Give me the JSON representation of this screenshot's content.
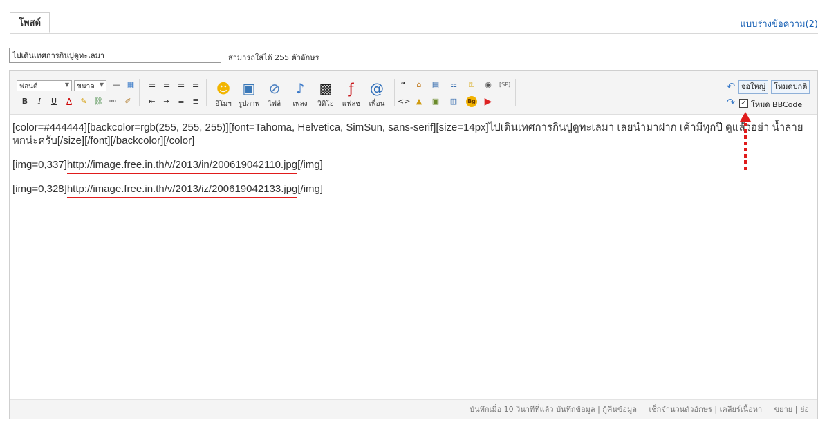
{
  "tab": {
    "label": "โพสต์"
  },
  "drafts_link": "แบบร่างข้อความ(2)",
  "subject": {
    "value": "ไปเดินเทศการกินปูดูทะเลมา",
    "hint": "สามารถใส่ได้ 255 ตัวอักษร"
  },
  "toolbar": {
    "font_select": "ฟอนต์",
    "size_select": "ขนาด",
    "format": {
      "bold": "B",
      "italic": "I",
      "underline": "U"
    },
    "media_buttons": [
      {
        "label": "อิโมฯ",
        "icon": "smiley-icon"
      },
      {
        "label": "รูปภาพ",
        "icon": "image-icon"
      },
      {
        "label": "ไฟล์",
        "icon": "paperclip-icon"
      },
      {
        "label": "เพลง",
        "icon": "music-note-icon"
      },
      {
        "label": "วิดิโอ",
        "icon": "clapperboard-icon"
      },
      {
        "label": "แฟลช",
        "icon": "flash-icon"
      },
      {
        "label": "เพื่อน",
        "icon": "at-icon"
      }
    ],
    "sp_tag": "[SP]",
    "bg_tag": "Bg",
    "fullscreen_button": "จอใหญ่",
    "normal_mode_button": "โหมดปกติ",
    "bbcode_mode_label": "โหมด BBCode",
    "bbcode_mode_checked": true
  },
  "content": {
    "line1": "[color=#444444][backcolor=rgb(255, 255, 255)][font=Tahoma, Helvetica, SimSun, sans-serif][size=14px]ไปเดินเทศการกินปูดูทะเลมา เลยนำมาฝาก เค้ามีทุกปี ดูแล้วอย่า น้ำลายหกน่ะครับ[/size][/font][/backcolor][/color]",
    "img1_prefix": "[img=0,337]",
    "img1_url": "http://image.free.in.th/v/2013/in/200619042110.jpg",
    "img1_suffix": "[/img]",
    "img2_prefix": "[img=0,328]",
    "img2_url": "http://image.free.in.th/v/2013/iz/200619042133.jpg",
    "img2_suffix": "[/img]"
  },
  "status_bar": {
    "autosave": "บันทึกเมื่อ 10 วินาทีที่แล้ว",
    "save_data": "บันทึกข้อมูล",
    "restore_data": "กู้คืนข้อมูล",
    "check_length": "เช็กจำนวนตัวอักษร",
    "clear_content": "เคลียร์เนื้อหา",
    "expand": "ขยาย",
    "shrink": "ย่อ"
  },
  "colors": {
    "link": "#1a62b6",
    "underline": "#e01b1b",
    "arrow": "#e01b1b"
  }
}
